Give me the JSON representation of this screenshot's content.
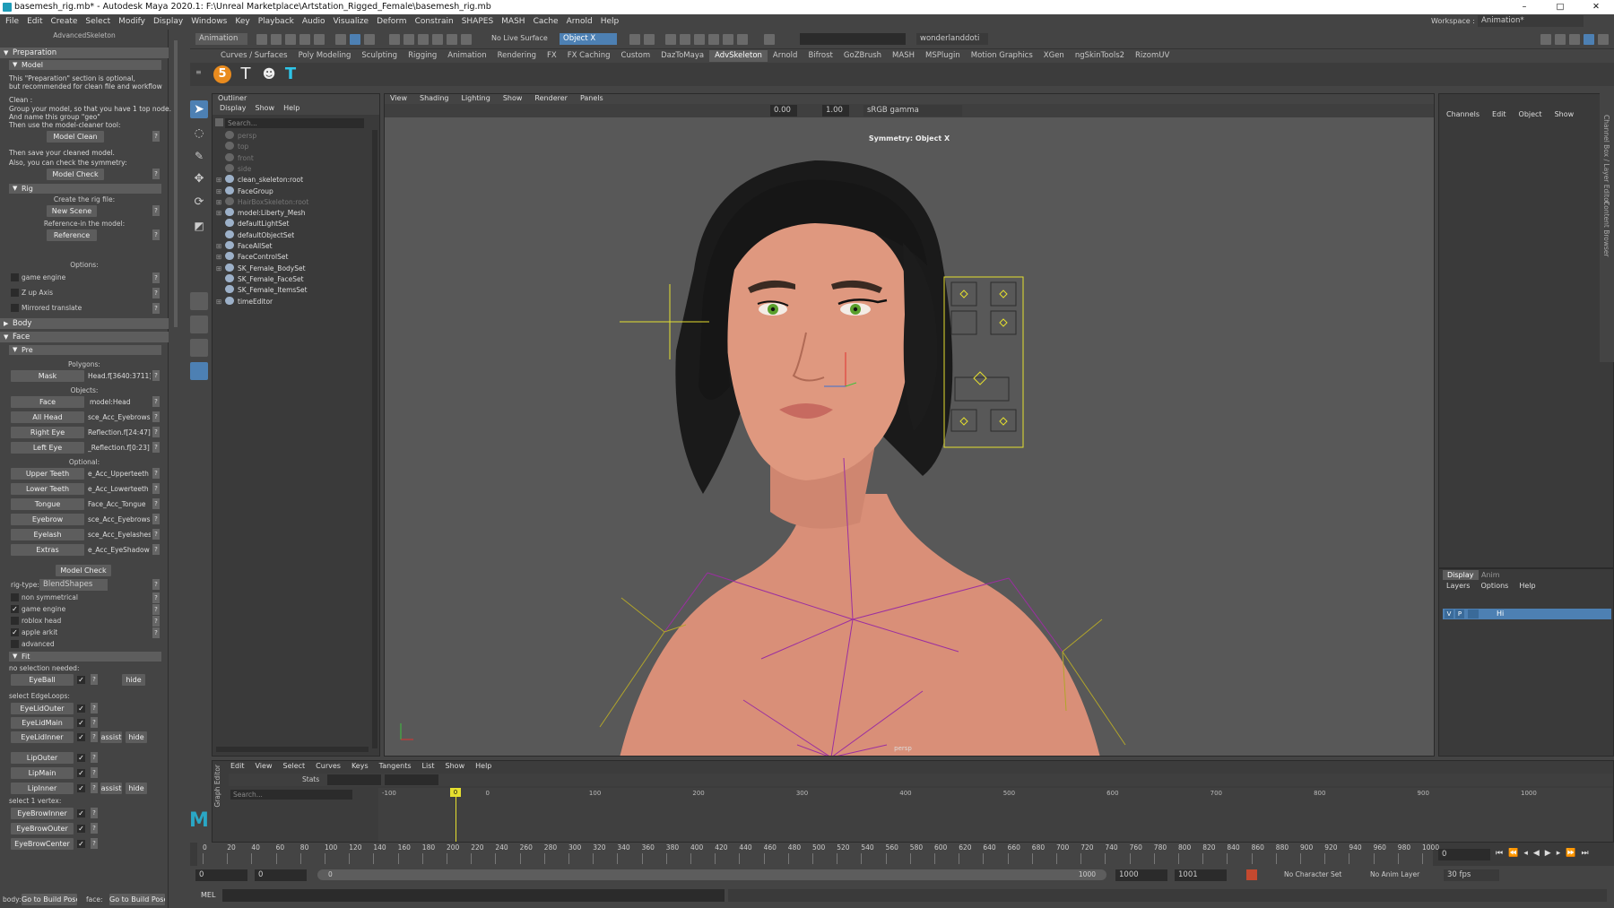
{
  "window": {
    "title": "basemesh_rig.mb* - Autodesk Maya 2020.1: F:\\Unreal Marketplace\\Artstation_Rigged_Female\\basemesh_rig.mb",
    "min": "–",
    "max": "□",
    "close": "✕"
  },
  "menubar": [
    "File",
    "Edit",
    "Create",
    "Select",
    "Modify",
    "Display",
    "Windows",
    "Key",
    "Playback",
    "Audio",
    "Visualize",
    "Deform",
    "Constrain",
    "SHAPES",
    "MASH",
    "Cache",
    "Arnold",
    "Help"
  ],
  "statusline": {
    "menuset": "Animation",
    "live_surface": "No Live Surface",
    "symmetry": "Object X",
    "user": "wonderlanddoti",
    "workspace_label": "Workspace :",
    "workspace": "Animation*"
  },
  "shelf_tabs": [
    "Curves / Surfaces",
    "Poly Modeling",
    "Sculpting",
    "Rigging",
    "Animation",
    "Rendering",
    "FX",
    "FX Caching",
    "Custom",
    "DazToMaya",
    "AdvSkeleton",
    "Arnold",
    "Bifrost",
    "GoZBrush",
    "MASH",
    "MSPlugin",
    "Motion Graphics",
    "XGen",
    "ngSkinTools2",
    "RizomUV"
  ],
  "shelf_active": "AdvSkeleton",
  "asp": {
    "title": "AdvancedSkeleton",
    "preparation": "Preparation",
    "model": "Model",
    "intro1": "This \"Preparation\" section is optional,",
    "intro2": "but recommended for clean file and workflow",
    "clean_lbl": "Clean :",
    "clean1": "Group your model, so that you have 1 top node.",
    "clean2": "And name this group \"geo\"",
    "clean3": "Then use the model-cleaner tool:",
    "model_clean": "Model Clean",
    "save1": "Then save your cleaned model.",
    "save2": "Also, you can check the symmetry:",
    "model_check": "Model Check",
    "rig": "Rig",
    "create_rig": "Create the rig file:",
    "new_scene": "New Scene",
    "ref_model": "Reference-in the model:",
    "reference": "Reference",
    "options": "Options:",
    "opt_game": "game engine",
    "opt_zup": "Z up Axis",
    "opt_mirror": "Mirrored translate",
    "body": "Body",
    "face": "Face",
    "pre": "Pre",
    "polygons": "Polygons:",
    "mask": "Mask",
    "mask_val": "Head.f[3640:3711]",
    "objects": "Objects:",
    "face_btn": "Face",
    "face_val": "model:Head",
    "allhead": "All Head",
    "allhead_val": "sce_Acc_Eyebrows",
    "righteye": "Right Eye",
    "righteye_val": "Reflection.f[24:47]",
    "lefteye": "Left Eye",
    "lefteye_val": "_Reflection.f[0:23]",
    "optional": "Optional:",
    "upperteeth": "Upper Teeth",
    "upperteeth_val": "e_Acc_Upperteeth",
    "lowerteeth": "Lower Teeth",
    "lowerteeth_val": "e_Acc_Lowerteeth",
    "tongue": "Tongue",
    "tongue_val": "Face_Acc_Tongue",
    "eyebrow": "Eyebrow",
    "eyebrow_val": "sce_Acc_Eyebrows",
    "eyelash": "Eyelash",
    "eyelash_val": "sce_Acc_Eyelashes",
    "extras": "Extras",
    "extras_val": "e_Acc_EyeShadow",
    "model_check2": "Model Check",
    "rigtype_lbl": "rig-type:",
    "rigtype": "BlendShapes",
    "nonsym": "non symmetrical",
    "game2": "game engine",
    "roblox": "roblox head",
    "arkit": "apple arkit",
    "advanced": "advanced",
    "fit": "Fit",
    "nosel": "no selection needed:",
    "eyeball": "EyeBall",
    "hide": "hide",
    "selloops": "select EdgeLoops:",
    "eyelidouter": "EyeLidOuter",
    "eyelidmain": "EyeLidMain",
    "eyelidinner": "EyeLidInner",
    "assist": "assist",
    "lipouter": "LipOuter",
    "lipmain": "LipMain",
    "lipinner": "LipInner",
    "sel1": "select 1 vertex:",
    "browinner": "EyeBrowInner",
    "browouter": "EyeBrowOuter",
    "browcenter": "EyeBrowCenter",
    "body_lbl": "body:",
    "face_lbl": "face:",
    "build_pose": "Go to Build Pose",
    "build_pose2": "Go to Build Pose",
    "check": "✓",
    "q": "?"
  },
  "outliner": {
    "title": "Outliner",
    "menu": [
      "Display",
      "Show",
      "Help"
    ],
    "search": "Search...",
    "items": [
      {
        "label": "persp",
        "dim": true,
        "exp": ""
      },
      {
        "label": "top",
        "dim": true,
        "exp": ""
      },
      {
        "label": "front",
        "dim": true,
        "exp": ""
      },
      {
        "label": "side",
        "dim": true,
        "exp": ""
      },
      {
        "label": "clean_skeleton:root",
        "dim": false,
        "exp": "⊞"
      },
      {
        "label": "FaceGroup",
        "dim": false,
        "exp": "⊞"
      },
      {
        "label": "HairBoxSkeleton:root",
        "dim": true,
        "exp": "⊞"
      },
      {
        "label": "model:Liberty_Mesh",
        "dim": false,
        "exp": "⊞"
      },
      {
        "label": "defaultLightSet",
        "dim": false,
        "exp": ""
      },
      {
        "label": "defaultObjectSet",
        "dim": false,
        "exp": ""
      },
      {
        "label": "FaceAllSet",
        "dim": false,
        "exp": "⊞"
      },
      {
        "label": "FaceControlSet",
        "dim": false,
        "exp": "⊞"
      },
      {
        "label": "SK_Female_BodySet",
        "dim": false,
        "exp": "⊞"
      },
      {
        "label": "SK_Female_FaceSet",
        "dim": false,
        "exp": ""
      },
      {
        "label": "SK_Female_ItemsSet",
        "dim": false,
        "exp": ""
      },
      {
        "label": "timeEditor",
        "dim": false,
        "exp": "⊞"
      }
    ]
  },
  "viewport": {
    "menu": [
      "View",
      "Shading",
      "Lighting",
      "Show",
      "Renderer",
      "Panels"
    ],
    "exposure": "0.00",
    "gamma": "1.00",
    "colorspace": "sRGB gamma",
    "symmetry_label": "Symmetry: Object X",
    "camera": "persp"
  },
  "channelbox": {
    "menu": [
      "Channels",
      "Edit",
      "Object",
      "Show"
    ],
    "side_tabs": [
      "Channel Box / Layer Editor",
      "Content Browser"
    ]
  },
  "layers": {
    "tabs": [
      "Display",
      "Anim"
    ],
    "menu": [
      "Layers",
      "Options",
      "Help"
    ],
    "layer_name": "Hi",
    "v": "V",
    "p": "P"
  },
  "grapheditor": {
    "side_label": "Graph Editor",
    "menu": [
      "Edit",
      "View",
      "Select",
      "Curves",
      "Keys",
      "Tangents",
      "List",
      "Show",
      "Help"
    ],
    "stats": "Stats",
    "search": "Search...",
    "ticks": [
      "-100",
      "0",
      "100",
      "200",
      "300",
      "400",
      "500",
      "600",
      "700",
      "800",
      "900",
      "1000"
    ],
    "current": "0"
  },
  "timeslider": {
    "ticks": [
      "0",
      "20",
      "40",
      "60",
      "80",
      "100",
      "120",
      "140",
      "160",
      "180",
      "200",
      "220",
      "240",
      "260",
      "280",
      "300",
      "320",
      "340",
      "360",
      "380",
      "400",
      "420",
      "440",
      "460",
      "480",
      "500",
      "520",
      "540",
      "560",
      "580",
      "600",
      "620",
      "640",
      "660",
      "680",
      "700",
      "720",
      "740",
      "760",
      "780",
      "800",
      "820",
      "840",
      "860",
      "880",
      "900",
      "920",
      "940",
      "960",
      "980",
      "1000"
    ],
    "current": "0"
  },
  "rangebar": {
    "start": "0",
    "range_start": "0",
    "range_inner": "0",
    "range_end": "1000",
    "end": "1000",
    "anim_end": "1001",
    "character": "No Character Set",
    "anim_layer": "No Anim Layer",
    "fps": "30 fps"
  },
  "mel": {
    "label": "MEL"
  },
  "logo": "M",
  "colors": {
    "accent": "#4d80b3",
    "active_field": "#4d80b3",
    "bg": "#444444",
    "panel": "#3a3a3a",
    "hair": "#1a1a1a",
    "skin": "#d98f78",
    "eye": "#5aa02c",
    "control": "#e5df2f"
  }
}
